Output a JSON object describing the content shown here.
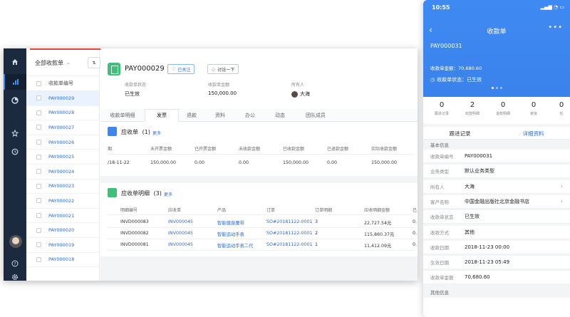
{
  "desktop": {
    "list": {
      "filter_label": "全部收款单",
      "filter_caret": "⌄",
      "sort_icon": "⇅",
      "col_header": "收款单编号",
      "rows": [
        "PAY000029",
        "PAY000028",
        "PAY000027",
        "PAY000026",
        "PAY000025",
        "PAY000024",
        "PAY000023",
        "PAY000022",
        "PAY000021",
        "PAY000020",
        "PAY000019",
        "PAY000018"
      ],
      "selected_index": 0
    },
    "detail": {
      "title": "PAY000029",
      "follow_button": "已关注",
      "discuss_button": "讨论一下",
      "fields": [
        {
          "label": "收款单状态",
          "value": "已生效"
        },
        {
          "label": "收款单金额",
          "value": "150,000.00"
        },
        {
          "label": "所有人",
          "value": "大海"
        }
      ],
      "tabs": [
        "收款单明细",
        "发票",
        "退款",
        "资料",
        "办公",
        "动态",
        "团队成员"
      ],
      "active_tab": 1,
      "receivable": {
        "title": "应收单",
        "count": "(1)",
        "more": "更多",
        "headers": [
          "期",
          "未开票金额",
          "已开票金额",
          "未收款金额",
          "已收款金额",
          "已退款金额",
          "实际收款金额"
        ],
        "rows": [
          [
            "/18-11-22",
            "150,000.00",
            "0.00",
            "0.00",
            "150,000.00",
            "0.00",
            "150,000.00"
          ]
        ]
      },
      "receivable_detail": {
        "title": "应收单明细",
        "count": "(3)",
        "more": "更多",
        "headers": [
          "明细编号",
          "应收单",
          "产品",
          "订单",
          "订单明细",
          "应收明细金额",
          "已"
        ],
        "rows": [
          [
            "INVD000083",
            "INV000045",
            "智能健身腰带",
            "SO#20181122-0001",
            "3",
            "22,727.54元",
            "0."
          ],
          [
            "INVD000082",
            "INV000045",
            "智能运动手表",
            "SO#20181122-0001",
            "2",
            "115,860.37元",
            "0."
          ],
          [
            "INVD000081",
            "INV000045",
            "智能运动手表二代",
            "SO#20181122-0001",
            "1",
            "11,412.09元",
            "0."
          ]
        ]
      }
    }
  },
  "phone": {
    "time": "10:55",
    "status_icons": "▂▄▆ ◔ ▭",
    "title": "收款单",
    "more": "•••",
    "id": "PAY000031",
    "amount_text": "收款单金额：70,680.60",
    "state_text": "收款单状态：已生效",
    "stats": [
      {
        "num": "0",
        "label": "跟进记录"
      },
      {
        "num": "2",
        "label": "收款明细"
      },
      {
        "num": "0",
        "label": "退款明细"
      },
      {
        "num": "0",
        "label": "审批"
      },
      {
        "num": "0",
        "label": "任"
      }
    ],
    "tabs": [
      "跟进记录",
      "详细资料"
    ],
    "active_tab": 1,
    "basic_header": "基本信息",
    "rows": [
      {
        "label": "收款单编号",
        "value": "PAY000031",
        "chevron": false
      },
      {
        "label": "业务类型",
        "value": "默认业务类型",
        "chevron": false
      },
      {
        "label": "所有人",
        "value": "大海",
        "chevron": true
      },
      {
        "label": "客户名称",
        "value": "中国金融出版社北京金融书店",
        "chevron": true
      },
      {
        "label": "收款单状态",
        "value": "已生效",
        "chevron": false
      },
      {
        "label": "收款方式",
        "value": "其他",
        "chevron": false
      },
      {
        "label": "收款日期",
        "value": "2018-11-23 00:00",
        "chevron": false
      },
      {
        "label": "生效日期",
        "value": "2018-11-23 05:49",
        "chevron": false
      },
      {
        "label": "收款单金额",
        "value": "70,680.60",
        "chevron": false
      }
    ],
    "other_header": "其他信息"
  },
  "colors": {
    "accent": "#2b6cd4",
    "nav_bg": "#1b2a3e",
    "green": "#3fbf77",
    "phone_header": "#3f8af2"
  }
}
